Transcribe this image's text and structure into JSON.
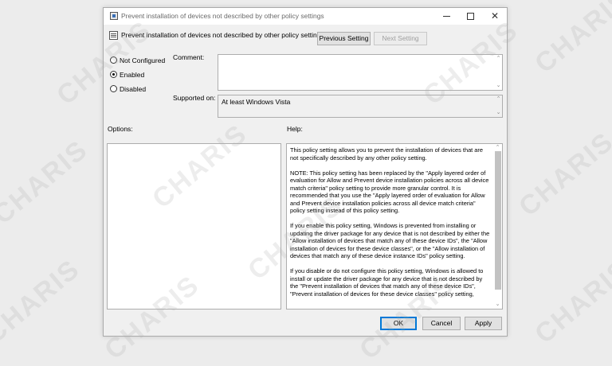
{
  "window": {
    "title": "Prevent installation of devices not described by other policy settings"
  },
  "header": {
    "title": "Prevent installation of devices not described by other policy settings",
    "previous_setting": "Previous Setting",
    "next_setting": "Next Setting"
  },
  "state": {
    "options": [
      "Not Configured",
      "Enabled",
      "Disabled"
    ],
    "selected": "Enabled"
  },
  "comment": {
    "label": "Comment:",
    "value": ""
  },
  "supported": {
    "label": "Supported on:",
    "value": "At least Windows Vista"
  },
  "options_panel": {
    "label": "Options:"
  },
  "help": {
    "label": "Help:",
    "paragraphs": [
      "This policy setting allows you to prevent the installation of devices that are not specifically described by any other policy setting.",
      "NOTE: This policy setting has been replaced by the \"Apply layered order of evaluation for Allow and Prevent device installation policies across all device match criteria\" policy setting to provide more granular control. It is recommended that you use the \"Apply layered order of evaluation for Allow and Prevent device installation policies across all device match criteria\" policy setting instead of this policy setting.",
      "If you enable this policy setting, Windows is prevented from installing or updating the driver package for any device that is not described by either the \"Allow installation of devices that match any of these device IDs\", the \"Allow installation of devices for these device classes\", or the \"Allow installation of devices that match any of these device instance IDs\" policy setting.",
      "If you disable or do not configure this policy setting, Windows is allowed to install or update the driver package for any device that is not described by the \"Prevent installation of devices that match any of these device IDs\", \"Prevent installation of devices for these device classes\" policy setting,"
    ]
  },
  "footer": {
    "ok": "OK",
    "cancel": "Cancel",
    "apply": "Apply"
  },
  "watermark": "CHARIS",
  "colors": {
    "accent": "#0078d7",
    "window_bg": "#f0f0f0"
  }
}
